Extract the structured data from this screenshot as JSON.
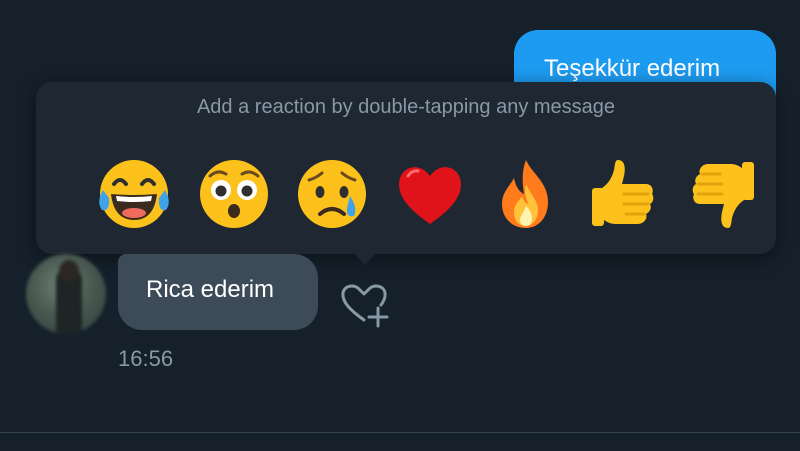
{
  "conversation": {
    "outgoing_message": {
      "text": "Teşekkür ederim",
      "receipt_partial": "1",
      "status_icon": "check-icon"
    },
    "incoming_message": {
      "text": "Rica ederim",
      "time": "16:56",
      "avatar": "avatar",
      "add_reaction_icon": "heart-plus-icon"
    }
  },
  "reaction_picker": {
    "hint": "Add a reaction by double-tapping any message",
    "reactions": [
      {
        "name": "laugh-cry-emoji-icon"
      },
      {
        "name": "surprised-emoji-icon"
      },
      {
        "name": "sad-tear-emoji-icon"
      },
      {
        "name": "heart-emoji-icon"
      },
      {
        "name": "fire-emoji-icon"
      },
      {
        "name": "thumbs-up-emoji-icon"
      },
      {
        "name": "thumbs-down-emoji-icon"
      }
    ]
  },
  "colors": {
    "background": "#15202b",
    "accent_blue": "#1d9bf0",
    "picker_bg": "#1e2732",
    "incoming_bubble": "#3d4b58",
    "secondary_text": "#8899a6"
  }
}
